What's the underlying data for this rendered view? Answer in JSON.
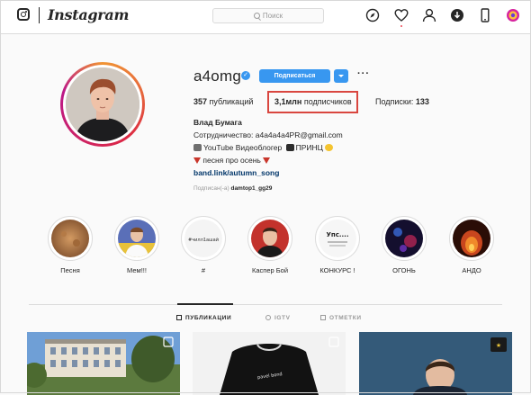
{
  "header": {
    "brand": "Instagram",
    "search_placeholder": "Поиск",
    "icons": [
      "instagram-glyph-icon",
      "compass-icon",
      "heart-icon",
      "profile-icon",
      "download-icon",
      "phone-icon",
      "browser-extension-icon"
    ]
  },
  "profile": {
    "username": "a4omg",
    "verified": true,
    "subscribe_label": "Подписаться",
    "more_label": "···",
    "stats": {
      "posts_count": "357",
      "posts_label": "публикаций",
      "followers_count": "3,1млн",
      "followers_label": "подписчиков",
      "following_label": "Подписки:",
      "following_count": "133"
    },
    "bio": {
      "name": "Влад Бумага",
      "line1": "Сотрудничество: a4a4a4a4PR@gmail.com",
      "line2_a": "YouTube Видеоблогер",
      "line2_b": "ПРИНЦ",
      "line3": "песня про осень",
      "link": "band.link/autumn_song",
      "followed_by_label": "Подписан(-а)",
      "followed_by_user": "damtop1_gg29"
    }
  },
  "stories": [
    {
      "label": "Песня"
    },
    {
      "label": "Мем!!!"
    },
    {
      "label": "#"
    },
    {
      "label": "Каспер Бой"
    },
    {
      "label": "КОНКУРС !"
    },
    {
      "label": "ОГОНЬ"
    },
    {
      "label": "АНДО"
    }
  ],
  "tabs": [
    {
      "label": "ПУБЛИКАЦИИ",
      "active": true
    },
    {
      "label": "IGTV",
      "active": false
    },
    {
      "label": "ОТМЕТКИ",
      "active": false
    }
  ],
  "story_thumb_text": {
    "hashtag": "#чилл1ашай",
    "konkurs": "Упс...."
  },
  "post_overlay_text": {
    "post2": "pavel bond"
  },
  "colors": {
    "accent": "#3897f0",
    "highlight_box": "#d9463f",
    "link": "#003569"
  }
}
